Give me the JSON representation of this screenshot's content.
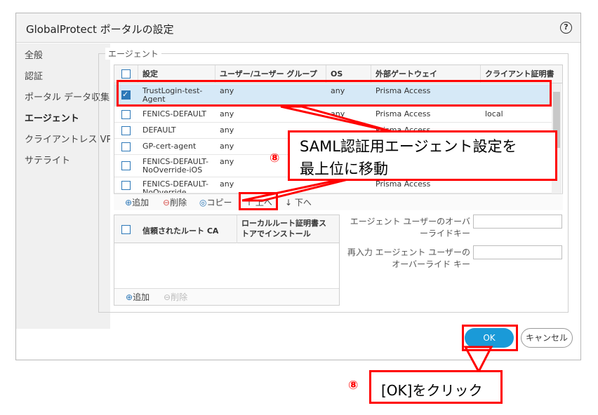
{
  "dialog": {
    "title": "GlobalProtect ポータルの設定",
    "help": "?"
  },
  "sidebar": {
    "items": [
      {
        "label": "全般"
      },
      {
        "label": "認証"
      },
      {
        "label": "ポータル データ収集"
      },
      {
        "label": "エージェント"
      },
      {
        "label": "クライアントレス VPN"
      },
      {
        "label": "サテライト"
      }
    ]
  },
  "agent": {
    "legend": "エージェント",
    "headers": [
      "設定",
      "ユーザー/ユーザー グループ",
      "OS",
      "外部ゲートウェイ",
      "クライアント証明書"
    ],
    "rows": [
      {
        "config": "TrustLogin-test-Agent",
        "user": "any",
        "os": "any",
        "gateway": "Prisma Access",
        "cert": ""
      },
      {
        "config": "FENICS-DEFAULT",
        "user": "any",
        "os": "any",
        "gateway": "Prisma Access",
        "cert": "local"
      },
      {
        "config": "DEFAULT",
        "user": "any",
        "os": "",
        "gateway": "Prisma Access",
        "cert": ""
      },
      {
        "config": "GP-cert-agent",
        "user": "any",
        "os": "",
        "gateway": "",
        "cert": ""
      },
      {
        "config": "FENICS-DEFAULT-NoOverride-iOS",
        "user": "any",
        "os": "",
        "gateway": "",
        "cert": ""
      },
      {
        "config": "FENICS-DEFAULT-NoOverride",
        "user": "any",
        "os": "",
        "gateway": "Prisma Access",
        "cert": ""
      }
    ],
    "toolbar": {
      "add": "追加",
      "delete": "削除",
      "copy": "コピー",
      "up": "上へ",
      "down": "下へ"
    }
  },
  "rootca": {
    "headers": [
      "信頼されたルート CA",
      "ローカルルート証明書ストアでインストール"
    ],
    "toolbar": {
      "add": "追加",
      "delete": "削除"
    }
  },
  "override": {
    "key_label": "エージェント ユーザーのオーバーライドキー",
    "reenter_label": "再入力 エージェント ユーザーのオーバーライド キー"
  },
  "buttons": {
    "ok": "OK",
    "cancel": "キャンセル"
  },
  "annotations": {
    "callout1_num": "⑧",
    "callout1_text": [
      "SAML認証用エージェント設定を",
      "最上位に移動"
    ],
    "callout2_num": "⑧",
    "callout2_text": "[OK]をクリック"
  }
}
